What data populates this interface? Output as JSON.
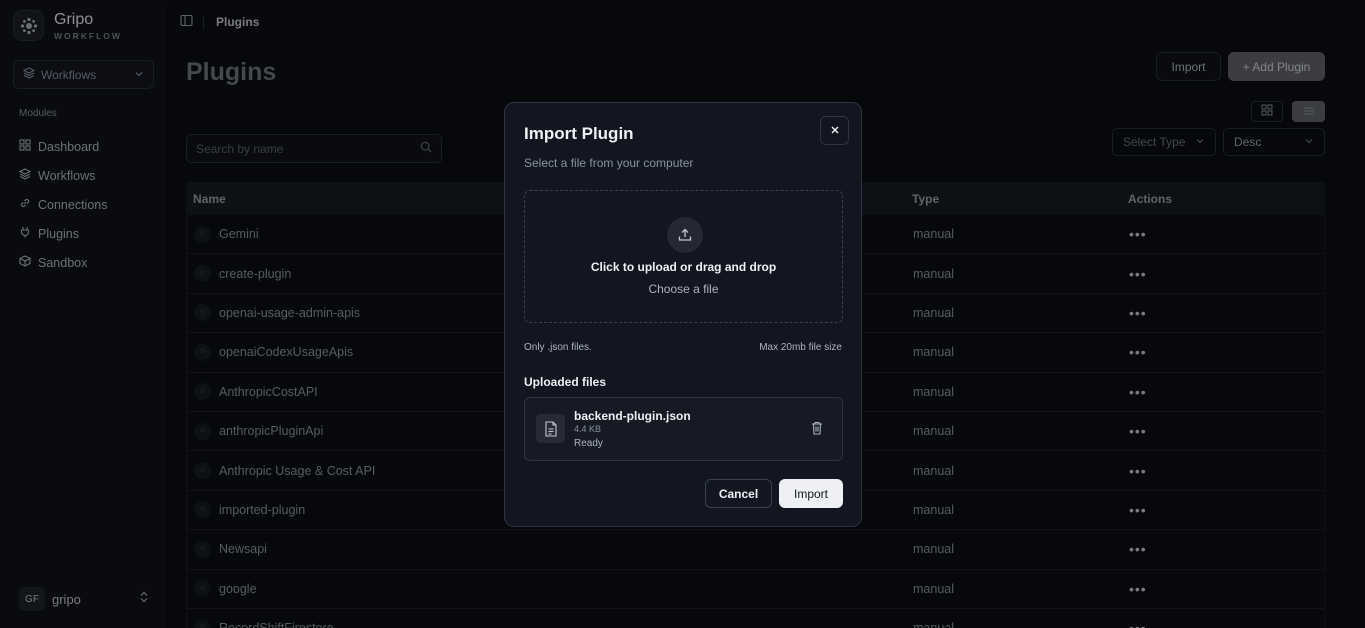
{
  "sidebar": {
    "brand_name": "Gripo",
    "brand_sub": "WORKFLOW",
    "workspace": "Workflows",
    "section": "Modules",
    "items": [
      {
        "label": "Dashboard",
        "icon": "grid-icon"
      },
      {
        "label": "Workflows",
        "icon": "layers-icon"
      },
      {
        "label": "Connections",
        "icon": "link-icon"
      },
      {
        "label": "Plugins",
        "icon": "plug-icon"
      },
      {
        "label": "Sandbox",
        "icon": "box-icon"
      }
    ],
    "user": {
      "initials": "GF",
      "name": "gripo"
    }
  },
  "header": {
    "breadcrumb": "Plugins"
  },
  "main": {
    "title": "Plugins",
    "import_label": "Import",
    "add_label": "+ Add Plugin",
    "search_placeholder": "Search by name",
    "filter_type": "Select Type",
    "sort": "Desc",
    "columns": {
      "name": "Name",
      "type": "Type",
      "actions": "Actions"
    },
    "rows": [
      {
        "name": "Gemini",
        "type": "manual"
      },
      {
        "name": "create-plugin",
        "type": "manual"
      },
      {
        "name": "openai-usage-admin-apis",
        "type": "manual"
      },
      {
        "name": "openaiCodexUsageApis",
        "type": "manual"
      },
      {
        "name": "AnthropicCostAPI",
        "type": "manual"
      },
      {
        "name": "anthropicPluginApi",
        "type": "manual"
      },
      {
        "name": "Anthropic Usage & Cost API",
        "type": "manual"
      },
      {
        "name": "imported-plugin",
        "type": "manual"
      },
      {
        "name": "Newsapi",
        "type": "manual"
      },
      {
        "name": "google",
        "type": "manual"
      },
      {
        "name": "RecordShiftFirestore",
        "type": "manual"
      }
    ],
    "row_icon_text": "SI",
    "actions_glyph": "•••"
  },
  "modal": {
    "title": "Import Plugin",
    "subtitle": "Select a file from your computer",
    "drop_main": "Click to upload or drag and drop",
    "drop_sub": "Choose a file",
    "hint_left": "Only .json files.",
    "hint_right": "Max 20mb file size",
    "uploaded_label": "Uploaded files",
    "file": {
      "name": "backend-plugin.json",
      "size": "4.4 KB",
      "status": "Ready"
    },
    "cancel": "Cancel",
    "import": "Import"
  }
}
